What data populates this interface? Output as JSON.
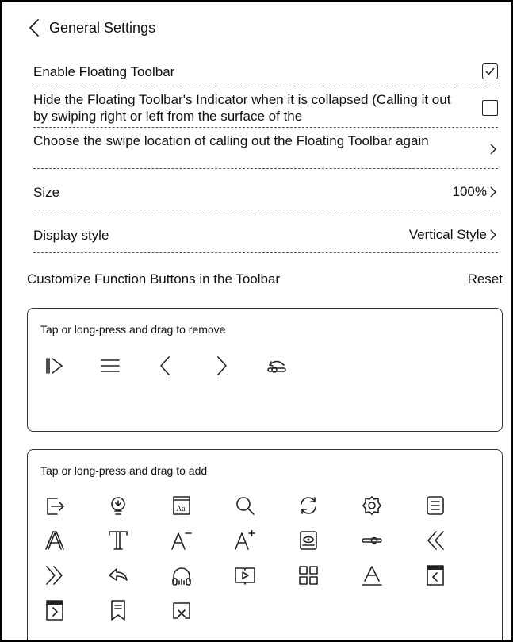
{
  "header": {
    "title": "General Settings",
    "back_icon": "chevron-left-icon"
  },
  "settings": {
    "enable_toolbar": {
      "label": "Enable Floating Toolbar",
      "checked": true
    },
    "hide_indicator": {
      "label": "Hide the Floating Toolbar's Indicator when it is collapsed (Calling it out by swiping right or left from the surface of the",
      "checked": false
    },
    "swipe_location": {
      "label": "Choose the swipe location of calling out the Floating Toolbar again"
    },
    "size": {
      "label": "Size",
      "value": "100%"
    },
    "display_style": {
      "label": "Display style",
      "value": "Vertical Style"
    }
  },
  "customize": {
    "title": "Customize Function Buttons in the Toolbar",
    "reset_label": "Reset"
  },
  "remove_panel": {
    "hint": "Tap or long-press and drag to remove",
    "icons": [
      "collapse-toolbar-icon",
      "menu-icon",
      "previous-page-icon",
      "next-page-icon",
      "refresh-mode-icon"
    ]
  },
  "add_panel": {
    "hint": "Tap or long-press and drag to add",
    "icons": [
      "exit-icon",
      "light-bulb-icon",
      "font-box-icon",
      "search-icon",
      "rotate-icon",
      "gear-icon",
      "table-of-contents-icon",
      "font-outline-icon",
      "text-format-icon",
      "font-decrease-icon",
      "font-increase-icon",
      "screenshot-icon",
      "slider-icon",
      "double-chevron-left-icon",
      "double-chevron-right-icon",
      "back-arrow-icon",
      "headphones-icon",
      "book-play-icon",
      "grid-icon",
      "underline-a-icon",
      "previous-chapter-icon",
      "next-chapter-icon",
      "bookmark-icon",
      "close-window-icon"
    ]
  }
}
